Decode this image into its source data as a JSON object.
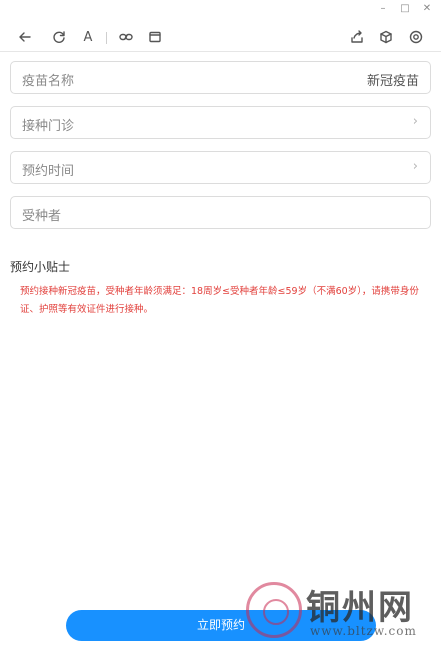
{
  "window": {
    "minimize": "–",
    "maximize": "□",
    "close": "✕"
  },
  "toolbar": {
    "font_label": "A",
    "icons": [
      "back-icon",
      "refresh-icon",
      "font-icon",
      "link-icon",
      "window-icon",
      "share-icon",
      "cube-icon",
      "settings-icon"
    ]
  },
  "form": {
    "vaccine": {
      "label": "疫苗名称",
      "value": "新冠疫苗"
    },
    "clinic": {
      "label": "接种门诊"
    },
    "time": {
      "label": "预约时间"
    },
    "recipient": {
      "label": "受种者"
    },
    "chevron": "›"
  },
  "tips": {
    "title": "预约小贴士",
    "body": "预约接种新冠疫苗，受种者年龄须满足：18周岁≤受种者年龄≤59岁（不满60岁），请携带身份证、护照等有效证件进行接种。"
  },
  "submit": {
    "label": "立即预约"
  },
  "watermark": {
    "text": "铜州网",
    "url": "www.bltzw.com"
  },
  "colors": {
    "accent": "#1891ff",
    "tips_text": "#e2403c"
  }
}
